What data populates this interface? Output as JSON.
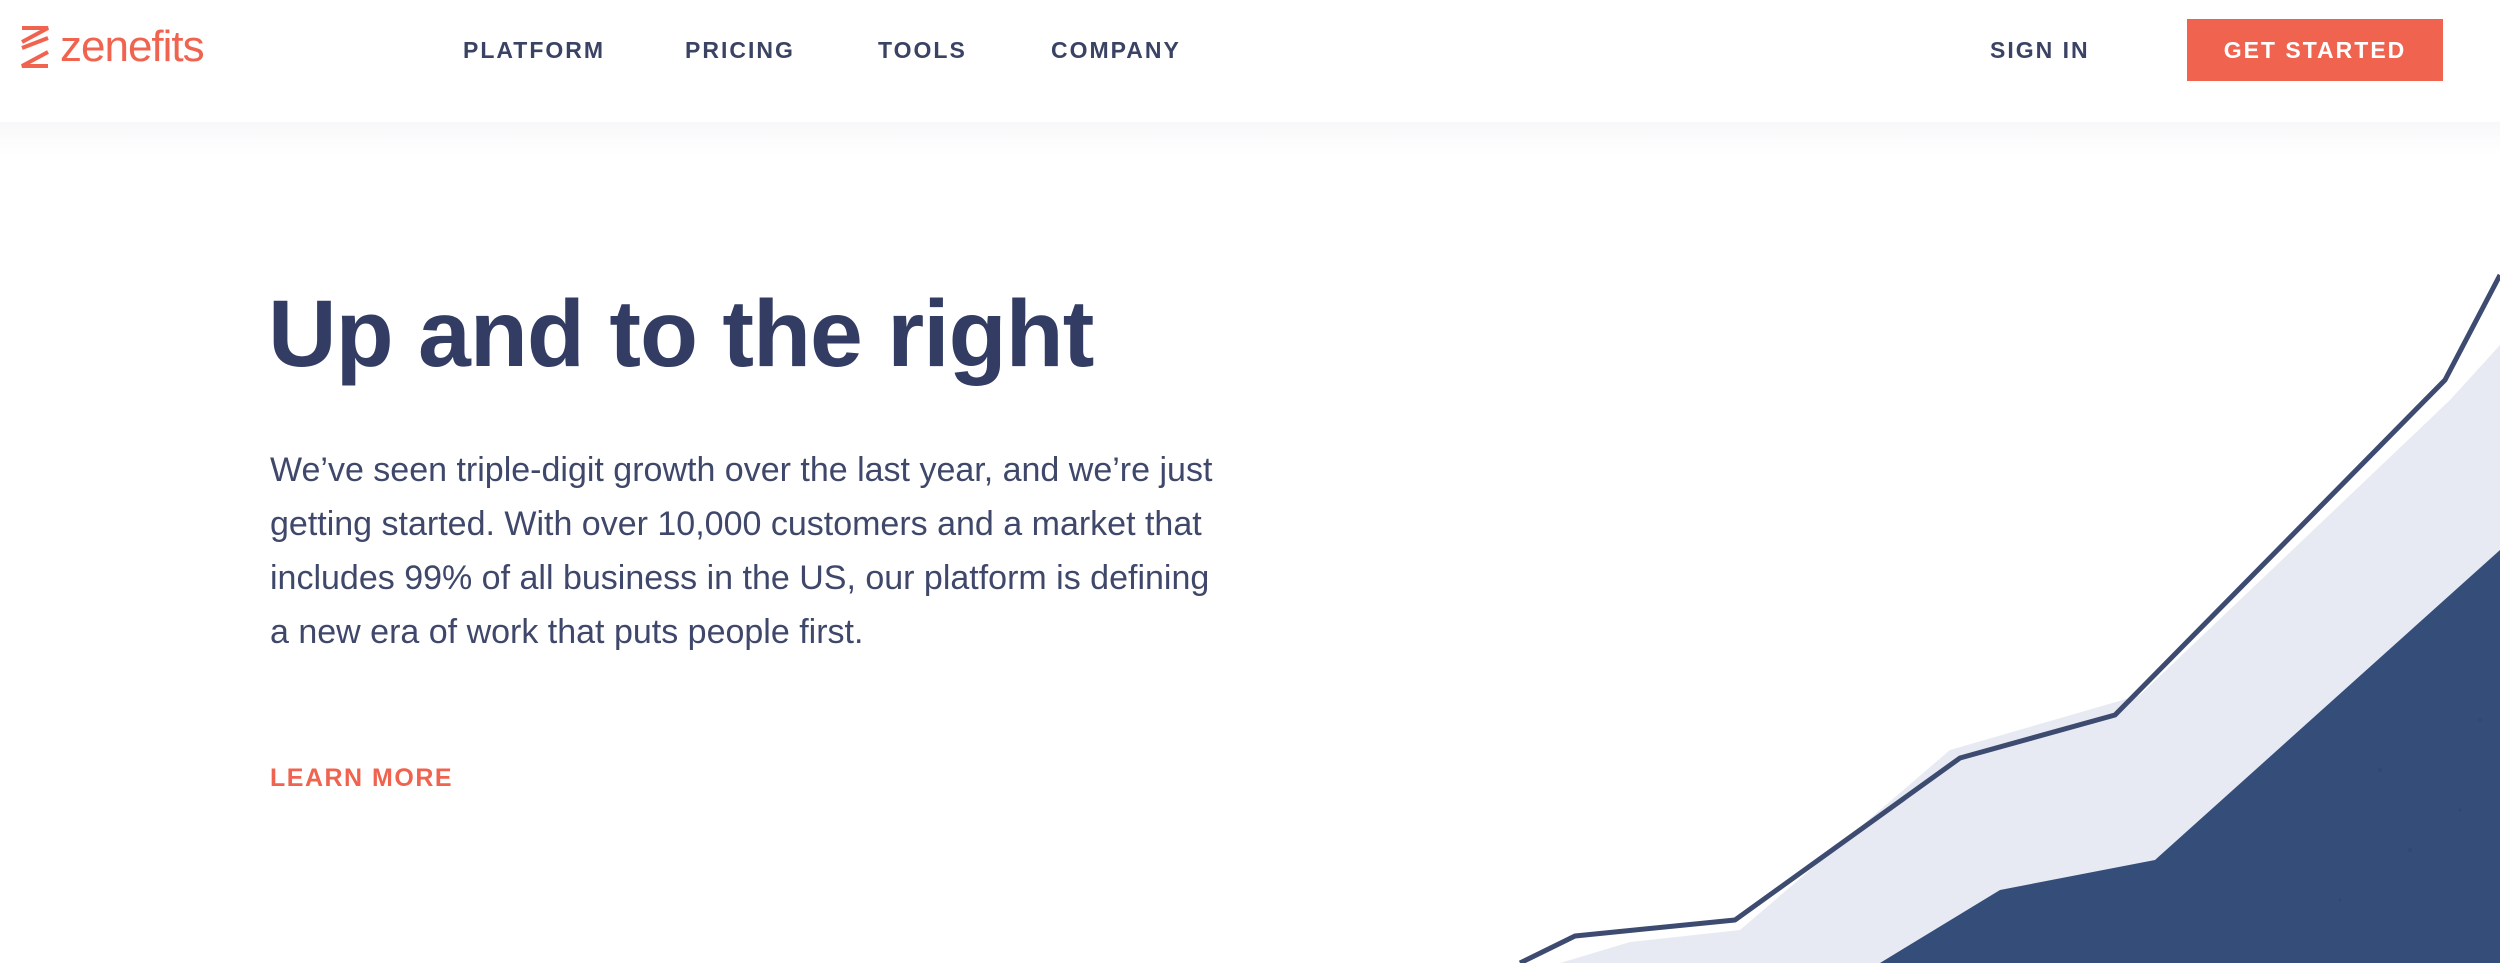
{
  "brand": {
    "name": "zenefits",
    "logo_icon": "zenefits-z-icon",
    "accent_color": "#f0644f",
    "text_color": "#3a4364"
  },
  "nav": {
    "items": [
      {
        "label": "PLATFORM"
      },
      {
        "label": "PRICING"
      },
      {
        "label": "TOOLS"
      },
      {
        "label": "COMPANY"
      }
    ],
    "sign_in": "SIGN IN",
    "cta": "GET STARTED"
  },
  "hero": {
    "title": "Up and to the right",
    "body": "We’ve seen triple-digit growth over the last year, and we’re just getting started. With over 10,000 customers and a market that includes 99% of all business in the US, our platform is defining a new era of work that puts people first.",
    "link": "LEARN MORE"
  },
  "illustration": {
    "name": "growth-graph",
    "colors": {
      "line": "#3d4b70",
      "band": "#e7eaf2",
      "fill": "#354d79"
    }
  }
}
